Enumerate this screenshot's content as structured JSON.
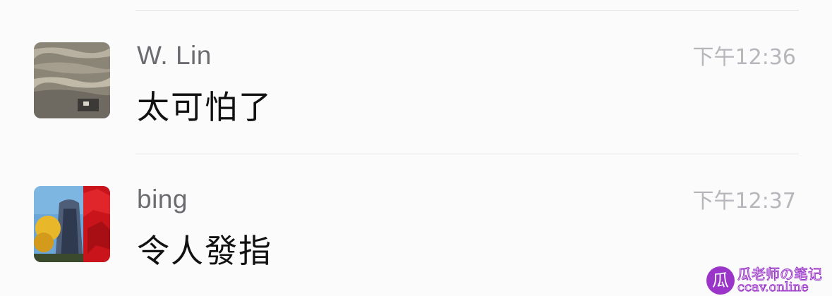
{
  "conversation": {
    "messages": [
      {
        "sender": "W. Lin",
        "time": "下午12:36",
        "text": "太可怕了",
        "avatar": "landscape-avatar"
      },
      {
        "sender": "bing",
        "time": "下午12:37",
        "text": "令人發指",
        "avatar": "city-avatar"
      }
    ]
  },
  "watermark": {
    "logo_glyph": "瓜",
    "line1": "瓜老师の笔记",
    "line2": "ccav.online"
  },
  "colors": {
    "background": "#fbfbfc",
    "divider": "#e2e2e6",
    "sender": "#6b6b70",
    "time": "#b6b6bb",
    "message": "#111111",
    "watermark": "#9b35c9"
  }
}
